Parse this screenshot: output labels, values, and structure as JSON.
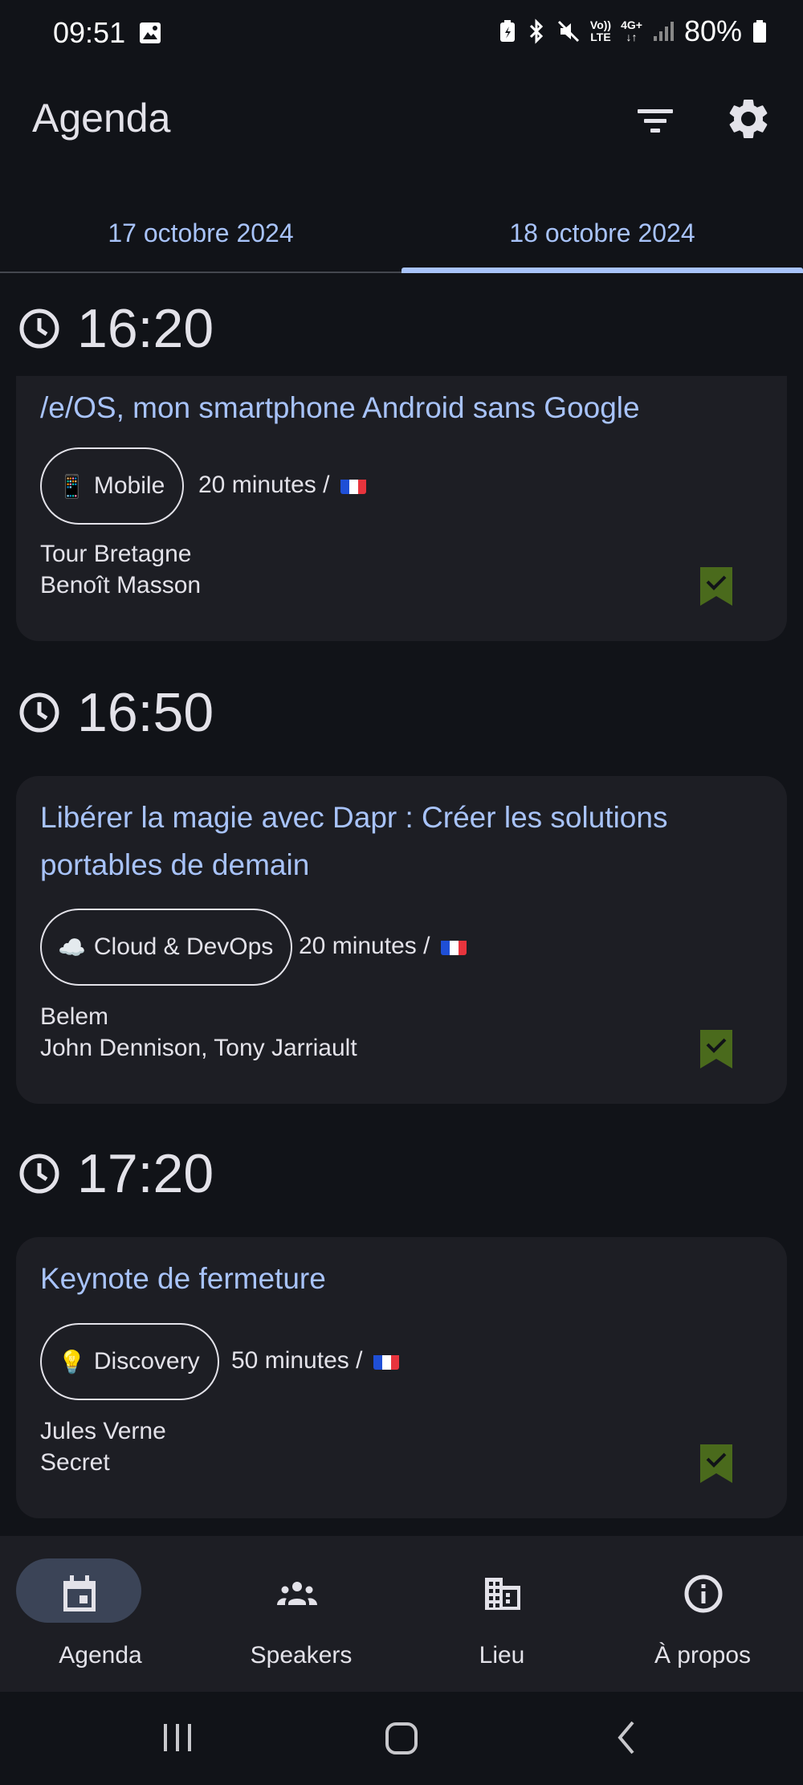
{
  "status_bar": {
    "time": "09:51",
    "network_line1": "Vo))",
    "network_line2": "LTE",
    "network_type": "4G+",
    "battery": "80%"
  },
  "app_bar": {
    "title": "Agenda",
    "actions": [
      "filter-icon",
      "gear-icon"
    ]
  },
  "tabs": [
    {
      "label": "17 octobre 2024",
      "selected": false
    },
    {
      "label": "18 octobre 2024",
      "selected": true
    }
  ],
  "schedule": [
    {
      "time": "16:20",
      "talk": {
        "title": "/e/OS, mon smartphone Android sans Google",
        "category_emoji": "📱",
        "category": "Mobile",
        "duration": "20 minutes /",
        "room": "Tour Bretagne",
        "speakers": "Benoît Masson",
        "bookmarked": true
      }
    },
    {
      "time": "16:50",
      "talk": {
        "title": "Libérer la magie avec Dapr : Créer les solutions portables de demain",
        "category_emoji": "☁️",
        "category": "Cloud & DevOps",
        "duration": "20 minutes /",
        "room": "Belem",
        "speakers": "John Dennison, Tony Jarriault",
        "bookmarked": true
      }
    },
    {
      "time": "17:20",
      "talk": {
        "title": "Keynote de fermeture",
        "category_emoji": "💡",
        "category": "Discovery",
        "duration": "50 minutes /",
        "room": "Jules Verne",
        "speakers": "Secret",
        "bookmarked": true
      }
    }
  ],
  "bottom_nav": [
    {
      "label": "Agenda",
      "icon": "calendar-icon",
      "selected": true
    },
    {
      "label": "Speakers",
      "icon": "group-icon",
      "selected": false
    },
    {
      "label": "Lieu",
      "icon": "building-icon",
      "selected": false
    },
    {
      "label": "À propos",
      "icon": "info-icon",
      "selected": false
    }
  ],
  "colors": {
    "background": "#111318",
    "card": "#1d1e24",
    "accent": "#a8c3fa",
    "bookmark": "#4a6a1c",
    "nav_pill": "#3b4457"
  }
}
